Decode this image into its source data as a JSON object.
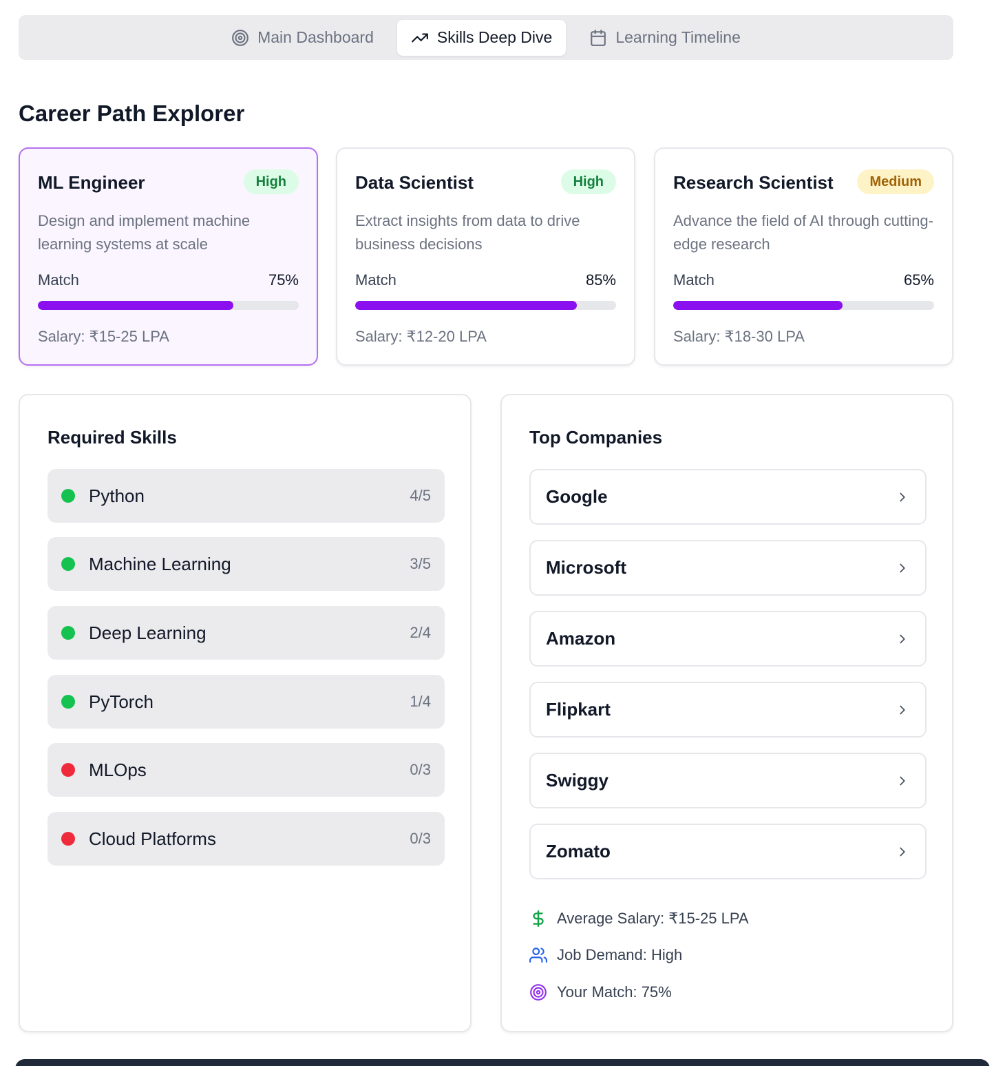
{
  "tabs": [
    {
      "label": "Main Dashboard",
      "icon": "target-icon"
    },
    {
      "label": "Skills Deep Dive",
      "icon": "trending-up-icon"
    },
    {
      "label": "Learning Timeline",
      "icon": "calendar-icon"
    }
  ],
  "active_tab": "Skills Deep Dive",
  "page_title": "Career Path Explorer",
  "careers": [
    {
      "name": "ML Engineer",
      "demand": "High",
      "description": "Design and implement machine learning systems at scale",
      "match_label": "Match",
      "match": "75%",
      "match_pct": 75,
      "salary": "Salary: ₹15-25 LPA",
      "selected": true
    },
    {
      "name": "Data Scientist",
      "demand": "High",
      "description": "Extract insights from data to drive business decisions",
      "match_label": "Match",
      "match": "85%",
      "match_pct": 85,
      "salary": "Salary: ₹12-20 LPA",
      "selected": false
    },
    {
      "name": "Research Scientist",
      "demand": "Medium",
      "description": "Advance the field of AI through cutting-edge research",
      "match_label": "Match",
      "match": "65%",
      "match_pct": 65,
      "salary": "Salary: ₹18-30 LPA",
      "selected": false
    }
  ],
  "skills_panel": {
    "title": "Required Skills",
    "skills": [
      {
        "name": "Python",
        "level": "4/5",
        "status": "green"
      },
      {
        "name": "Machine Learning",
        "level": "3/5",
        "status": "green"
      },
      {
        "name": "Deep Learning",
        "level": "2/4",
        "status": "green"
      },
      {
        "name": "PyTorch",
        "level": "1/4",
        "status": "green"
      },
      {
        "name": "MLOps",
        "level": "0/3",
        "status": "red"
      },
      {
        "name": "Cloud Platforms",
        "level": "0/3",
        "status": "red"
      }
    ]
  },
  "companies_panel": {
    "title": "Top Companies",
    "companies": [
      "Google",
      "Microsoft",
      "Amazon",
      "Flipkart",
      "Swiggy",
      "Zomato"
    ],
    "stats": {
      "salary": "Average Salary: ₹15-25 LPA",
      "demand": "Job Demand: High",
      "match": "Your Match: 75%"
    }
  },
  "colors": {
    "accent": "#8b10f0",
    "selected_border": "#b570f0",
    "green": "#16c24f",
    "red": "#ef2b3b",
    "high_badge_bg": "#dcfce7",
    "medium_badge_bg": "#fef3c7"
  }
}
